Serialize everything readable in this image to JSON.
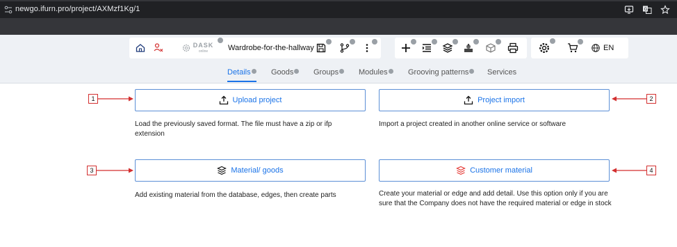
{
  "browser": {
    "url": "newgo.ifurn.pro/project/AXMzf1Kg/1",
    "actions": [
      "install-icon",
      "translate-icon",
      "star-icon"
    ]
  },
  "toolbar": {
    "home_icon": "home-icon",
    "logout_icon": "user-x-icon",
    "logo_text": "DASK",
    "logo_sub": "online",
    "project_name": "Wardrobe-for-the-hallway",
    "save_icon": "save-icon",
    "branch_icon": "branch-icon",
    "more_icon": "more-vertical-icon",
    "actions": [
      "plus-icon",
      "list-icon",
      "layers-icon",
      "machine-icon",
      "box-icon",
      "print-icon"
    ],
    "settings_icon": "gear-icon",
    "cart_icon": "cart-icon",
    "language": "EN"
  },
  "tabs": [
    {
      "label": "Details",
      "active": true
    },
    {
      "label": "Goods",
      "active": false
    },
    {
      "label": "Groups",
      "active": false
    },
    {
      "label": "Modules",
      "active": false
    },
    {
      "label": "Grooving patterns",
      "active": false
    },
    {
      "label": "Services",
      "active": false
    }
  ],
  "options": [
    {
      "marker": "1",
      "label": "Upload project",
      "icon": "upload-icon",
      "description": "Load the previously saved format. The file must have a zip or ifp extension"
    },
    {
      "marker": "2",
      "label": "Project import",
      "icon": "upload-icon",
      "description": "Import a project created in another online service or software"
    },
    {
      "marker": "3",
      "label": "Material/ goods",
      "icon": "layers-icon",
      "description": "Add existing material from the database, edges, then create parts"
    },
    {
      "marker": "4",
      "label": "Customer material",
      "icon": "layers-icon",
      "description": "Create your material or edge and add detail. Use this option only if you are sure that the Company does not have the required material or edge in stock"
    }
  ],
  "colors": {
    "accent": "#1a73e8",
    "marker_red": "#d32f2f",
    "customer_red": "#e53935"
  }
}
